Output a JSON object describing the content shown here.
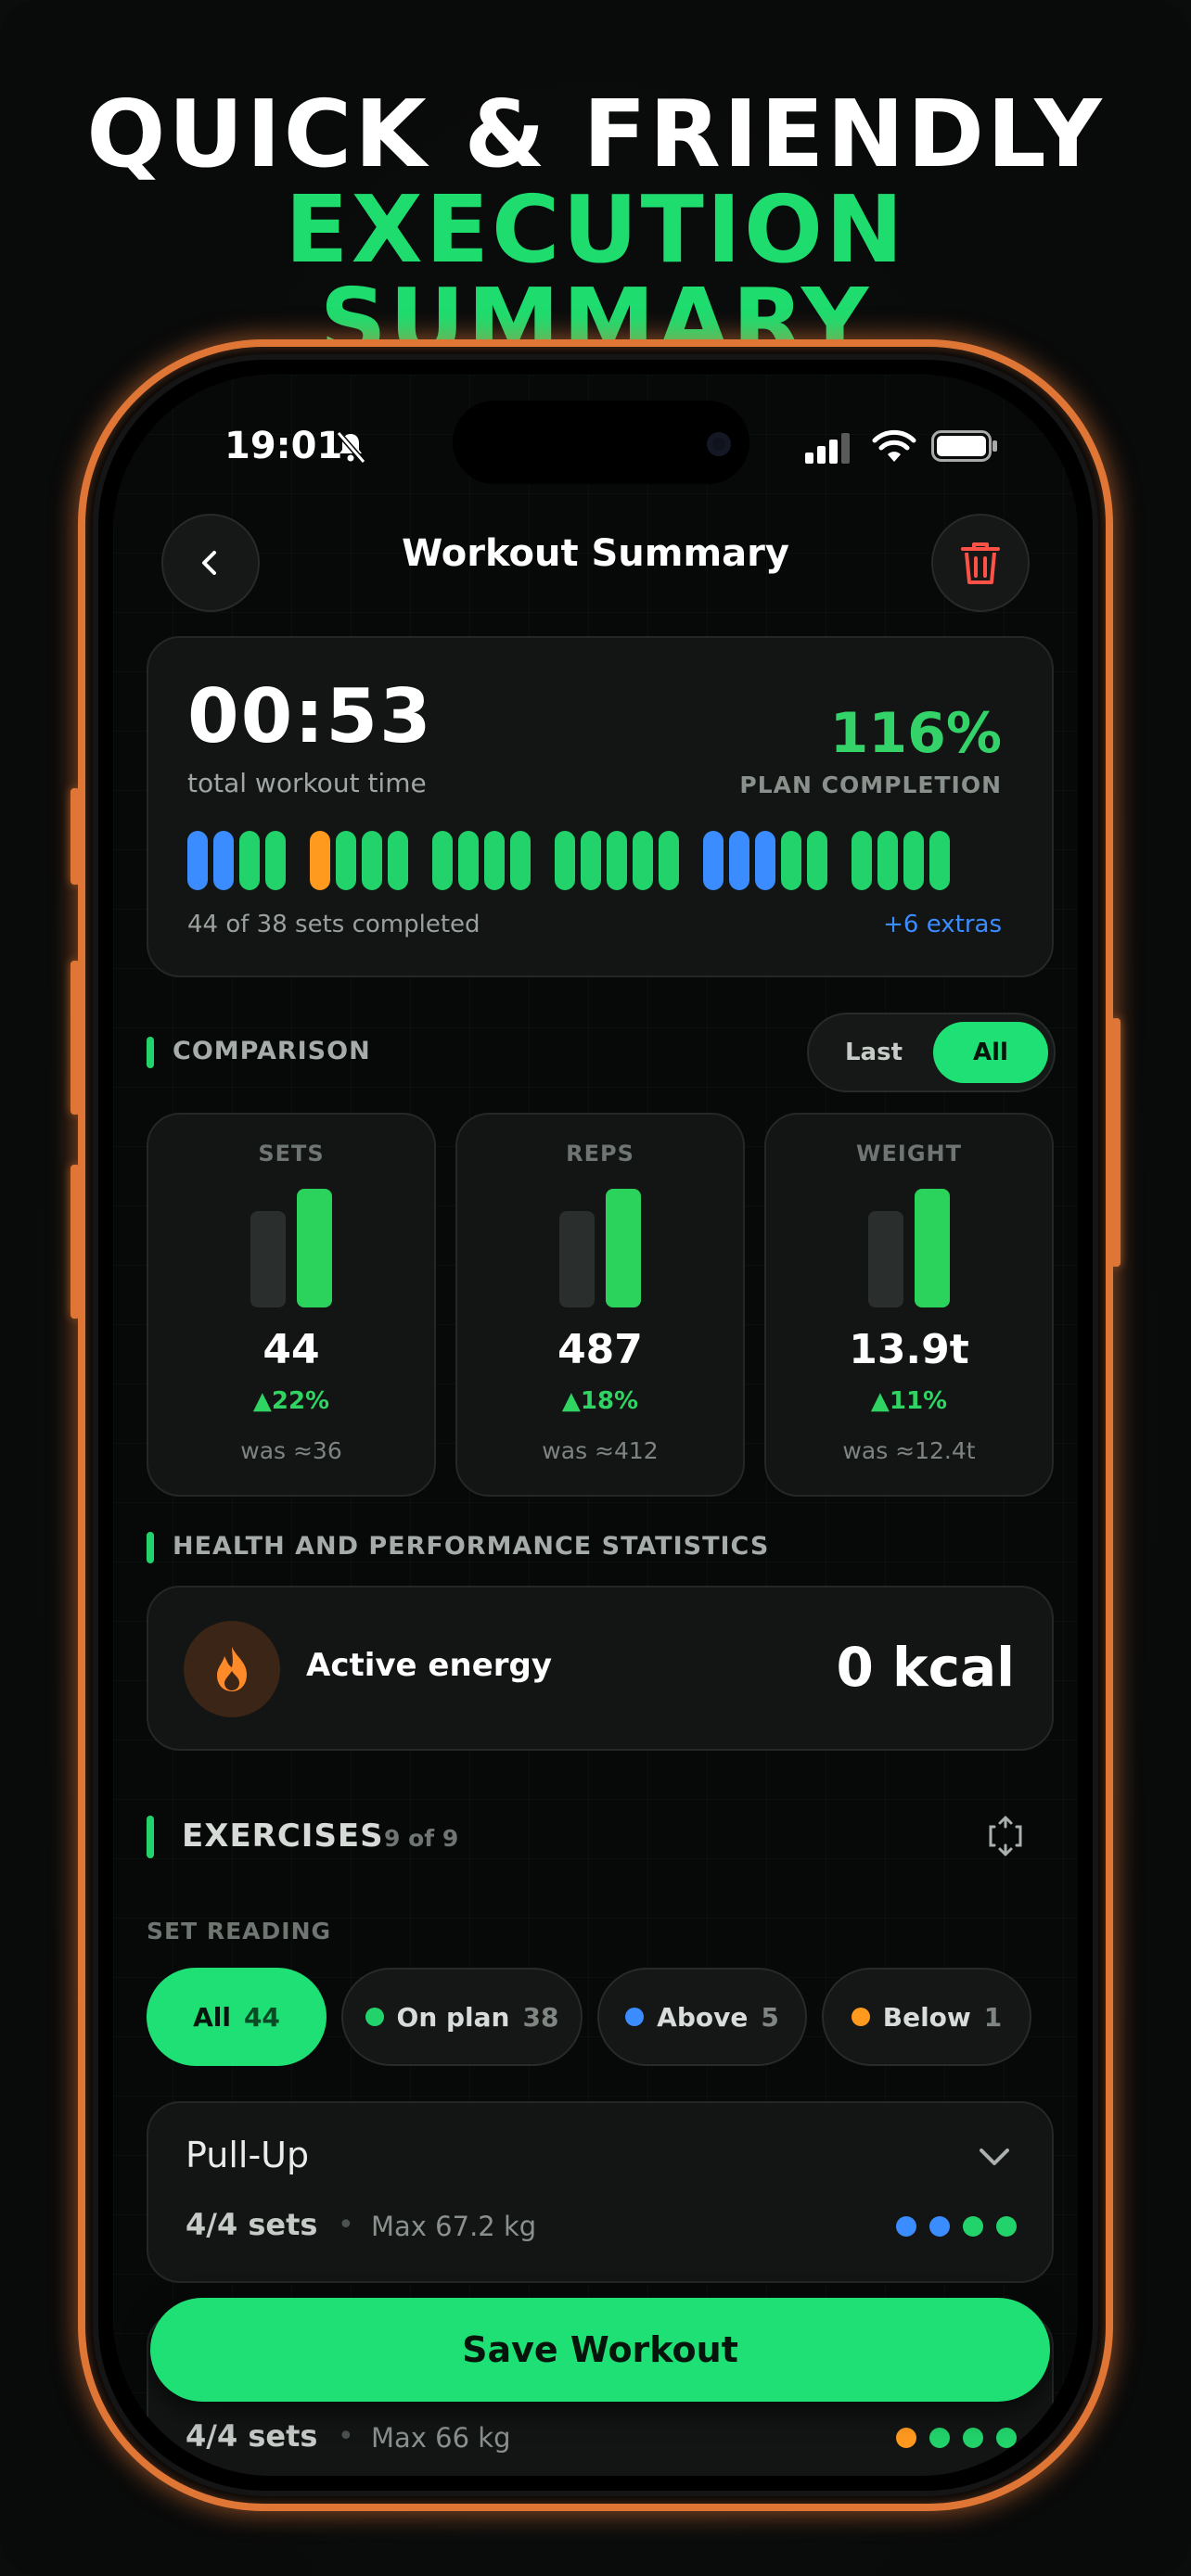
{
  "headline": {
    "line1": "QUICK & FRIENDLY",
    "line2": "EXECUTION SUMMARY"
  },
  "status_bar": {
    "time": "19:01"
  },
  "header": {
    "title": "Workout Summary"
  },
  "summary": {
    "total_time": "00:53",
    "total_time_label": "total workout time",
    "plan_completion": "116%",
    "plan_completion_label": "PLAN COMPLETION",
    "sets_note": "44 of 38 sets completed",
    "extras": "+6 extras"
  },
  "comparison": {
    "label": "COMPARISON",
    "toggle": {
      "last": "Last",
      "all": "All",
      "selected": "All"
    },
    "cards": [
      {
        "head": "SETS",
        "value": "44",
        "delta": "▲22%",
        "was": "was ≈36"
      },
      {
        "head": "REPS",
        "value": "487",
        "delta": "▲18%",
        "was": "was ≈412"
      },
      {
        "head": "WEIGHT",
        "value": "13.9t",
        "delta": "▲11%",
        "was": "was ≈12.4t"
      }
    ]
  },
  "health": {
    "label": "HEALTH AND PERFORMANCE STATISTICS",
    "energy_label": "Active energy",
    "energy_value": "0 kcal"
  },
  "exercises": {
    "title": "EXERCISES",
    "count": "9 of 9",
    "set_reading_label": "SET READING",
    "filters": [
      {
        "label": "All",
        "count": "44",
        "color": ""
      },
      {
        "label": "On plan",
        "count": "38",
        "color": "#22d36b"
      },
      {
        "label": "Above",
        "count": "5",
        "color": "#3b8cff"
      },
      {
        "label": "Below",
        "count": "1",
        "color": "#ff9a1f"
      }
    ],
    "items": [
      {
        "name": "Pull-Up",
        "sets": "4/4 sets",
        "max": "Max 67.2 kg",
        "dots": [
          "#3b8cff",
          "#3b8cff",
          "#22d36b",
          "#22d36b"
        ]
      },
      {
        "name": "",
        "sets": "4/4 sets",
        "max": "Max 66 kg",
        "dots": [
          "#ff9a1f",
          "#22d36b",
          "#22d36b",
          "#22d36b"
        ]
      }
    ]
  },
  "save_button": "Save Workout",
  "set_strip": {
    "groups": [
      [
        "#3b8cff",
        "#3b8cff",
        "#22d36b",
        "#22d36b"
      ],
      [
        "#ff9a1f",
        "#22d36b",
        "#22d36b",
        "#22d36b"
      ],
      [
        "#22d36b",
        "#22d36b",
        "#22d36b",
        "#22d36b"
      ],
      [
        "#22d36b",
        "#22d36b",
        "#22d36b",
        "#22d36b",
        "#22d36b"
      ],
      [
        "#3b8cff",
        "#3b8cff",
        "#3b8cff",
        "#22d36b",
        "#22d36b"
      ],
      [
        "#22d36b",
        "#22d36b",
        "#22d36b",
        "#22d36b"
      ]
    ]
  },
  "colors": {
    "accent": "#1ee074",
    "above": "#3b8cff",
    "below": "#ff9a1f",
    "on_plan": "#22d36b",
    "frame": "#e07636"
  }
}
